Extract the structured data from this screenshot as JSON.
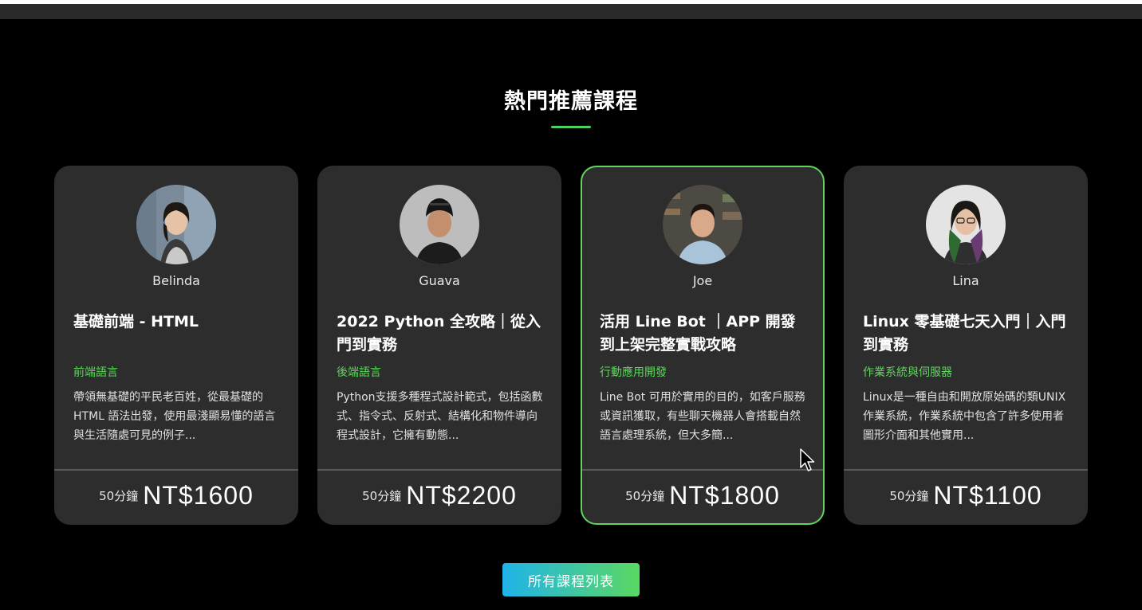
{
  "section": {
    "title": "熱門推薦課程"
  },
  "courses": [
    {
      "teacher": "Belinda",
      "title": "基礎前端 - HTML",
      "category": "前端語言",
      "description": "帶領無基礎的平民老百姓，從最基礎的 HTML 語法出發，使用最淺顯易懂的語言與生活隨處可見的例子...",
      "duration": "50分鐘",
      "price": "NT$1600"
    },
    {
      "teacher": "Guava",
      "title": "2022 Python 全攻略｜從入門到實務",
      "category": "後端語言",
      "description": "Python支援多種程式設計範式，包括函數式、指令式、反射式、結構化和物件導向程式設計，它擁有動態...",
      "duration": "50分鐘",
      "price": "NT$2200"
    },
    {
      "teacher": "Joe",
      "title": "活用 Line Bot ｜APP 開發到上架完整實戰攻略",
      "category": "行動應用開發",
      "description": "Line Bot 可用於實用的目的，如客戶服務或資訊獲取，有些聊天機器人會搭載自然語言處理系統，但大多簡...",
      "duration": "50分鐘",
      "price": "NT$1800"
    },
    {
      "teacher": "Lina",
      "title": "Linux 零基礎七天入門｜入門到實務",
      "category": "作業系統與伺服器",
      "description": "Linux是一種自由和開放原始碼的類UNIX作業系統，作業系統中包含了許多使用者圖形介面和其他實用...",
      "duration": "50分鐘",
      "price": "NT$1100"
    }
  ],
  "all_courses_button": "所有課程列表",
  "colors": {
    "accent": "#5fd55f",
    "card_bg": "#2d2d2d",
    "button_gradient_start": "#20b3ea",
    "button_gradient_end": "#5bd862"
  }
}
